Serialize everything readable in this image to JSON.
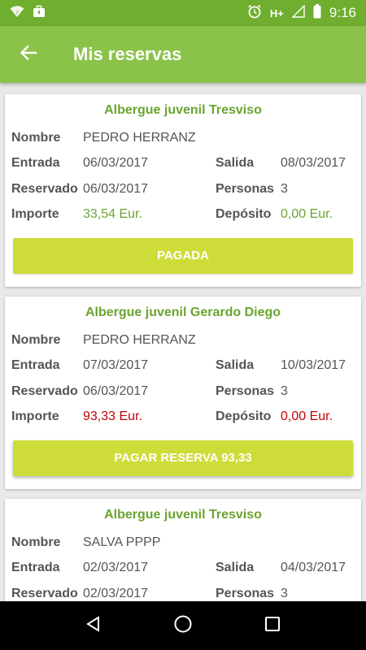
{
  "status_bar": {
    "network": "H+",
    "time": "9:16"
  },
  "app_bar": {
    "title": "Mis reservas"
  },
  "labels": {
    "nombre": "Nombre",
    "entrada": "Entrada",
    "salida": "Salida",
    "reservado": "Reservado",
    "personas": "Personas",
    "importe": "Importe",
    "deposito": "Depósito"
  },
  "reservations": [
    {
      "hostel": "Albergue juvenil Tresviso",
      "nombre": "PEDRO HERRANZ",
      "entrada": "06/03/2017",
      "salida": "08/03/2017",
      "reservado": "06/03/2017",
      "personas": "3",
      "importe": "33,54 Eur.",
      "deposito": "0,00 Eur.",
      "button": "PAGADA"
    },
    {
      "hostel": "Albergue juvenil Gerardo Diego",
      "nombre": "PEDRO HERRANZ",
      "entrada": "07/03/2017",
      "salida": "10/03/2017",
      "reservado": "06/03/2017",
      "personas": "3",
      "importe": "93,33 Eur.",
      "deposito": "0,00 Eur.",
      "button": "PAGAR RESERVA 93,33"
    },
    {
      "hostel": "Albergue juvenil Tresviso",
      "nombre": "SALVA PPPP",
      "entrada": "02/03/2017",
      "salida": "04/03/2017",
      "reservado": "02/03/2017",
      "personas": "3"
    }
  ],
  "colors": {
    "status_bar": "#6fae2e",
    "app_bar": "#8bc34a",
    "hostel_title": "#6aa42f",
    "paid_amount": "#6aa42f",
    "unpaid_amount": "#c40000",
    "button": "#cddc39"
  }
}
